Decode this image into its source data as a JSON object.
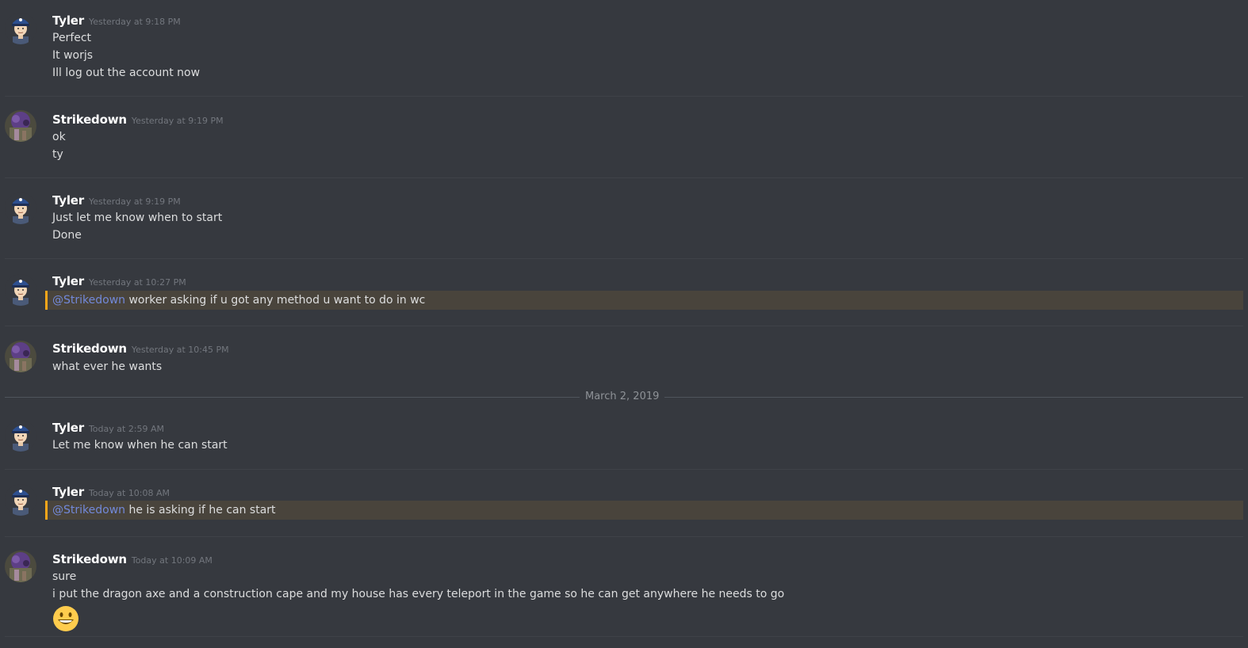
{
  "colors": {
    "background": "#36393f",
    "username": "#ffffff",
    "timestamp": "#72767d",
    "message_text": "#dcddde",
    "mention": "#7289da",
    "mention_highlight_bg": "#49443c",
    "mention_highlight_border": "#faa61a"
  },
  "date_divider": "March 2, 2019",
  "messages": [
    {
      "author": "Tyler",
      "avatar_icon": "police-officer-avatar",
      "timestamp": "Yesterday at 9:18 PM",
      "lines": [
        "Perfect",
        "It worjs",
        "Ill log out the account now"
      ]
    },
    {
      "author": "Strikedown",
      "avatar_icon": "purple-creature-avatar",
      "timestamp": "Yesterday at 9:19 PM",
      "lines": [
        "ok",
        "ty"
      ]
    },
    {
      "author": "Tyler",
      "avatar_icon": "police-officer-avatar",
      "timestamp": "Yesterday at 9:19 PM",
      "lines": [
        "Just let me know when to start",
        "Done"
      ]
    },
    {
      "author": "Tyler",
      "avatar_icon": "police-officer-avatar",
      "timestamp": "Yesterday at 10:27 PM",
      "mention": "@Strikedown",
      "text": " worker asking if u got any method u want to do in wc"
    },
    {
      "author": "Strikedown",
      "avatar_icon": "purple-creature-avatar",
      "timestamp": "Yesterday at 10:45 PM",
      "lines": [
        "what ever he wants"
      ]
    },
    {
      "author": "Tyler",
      "avatar_icon": "police-officer-avatar",
      "timestamp": "Today at 2:59 AM",
      "lines": [
        "Let me know when he can start"
      ]
    },
    {
      "author": "Tyler",
      "avatar_icon": "police-officer-avatar",
      "timestamp": "Today at 10:08 AM",
      "mention": "@Strikedown",
      "text": " he is asking if he can start"
    },
    {
      "author": "Strikedown",
      "avatar_icon": "purple-creature-avatar",
      "timestamp": "Today at 10:09 AM",
      "lines": [
        "sure",
        "i put the dragon axe and a construction cape and my house has every teleport in the game so he can get anywhere he needs to go"
      ],
      "emoji": "smiley-emoji"
    }
  ]
}
